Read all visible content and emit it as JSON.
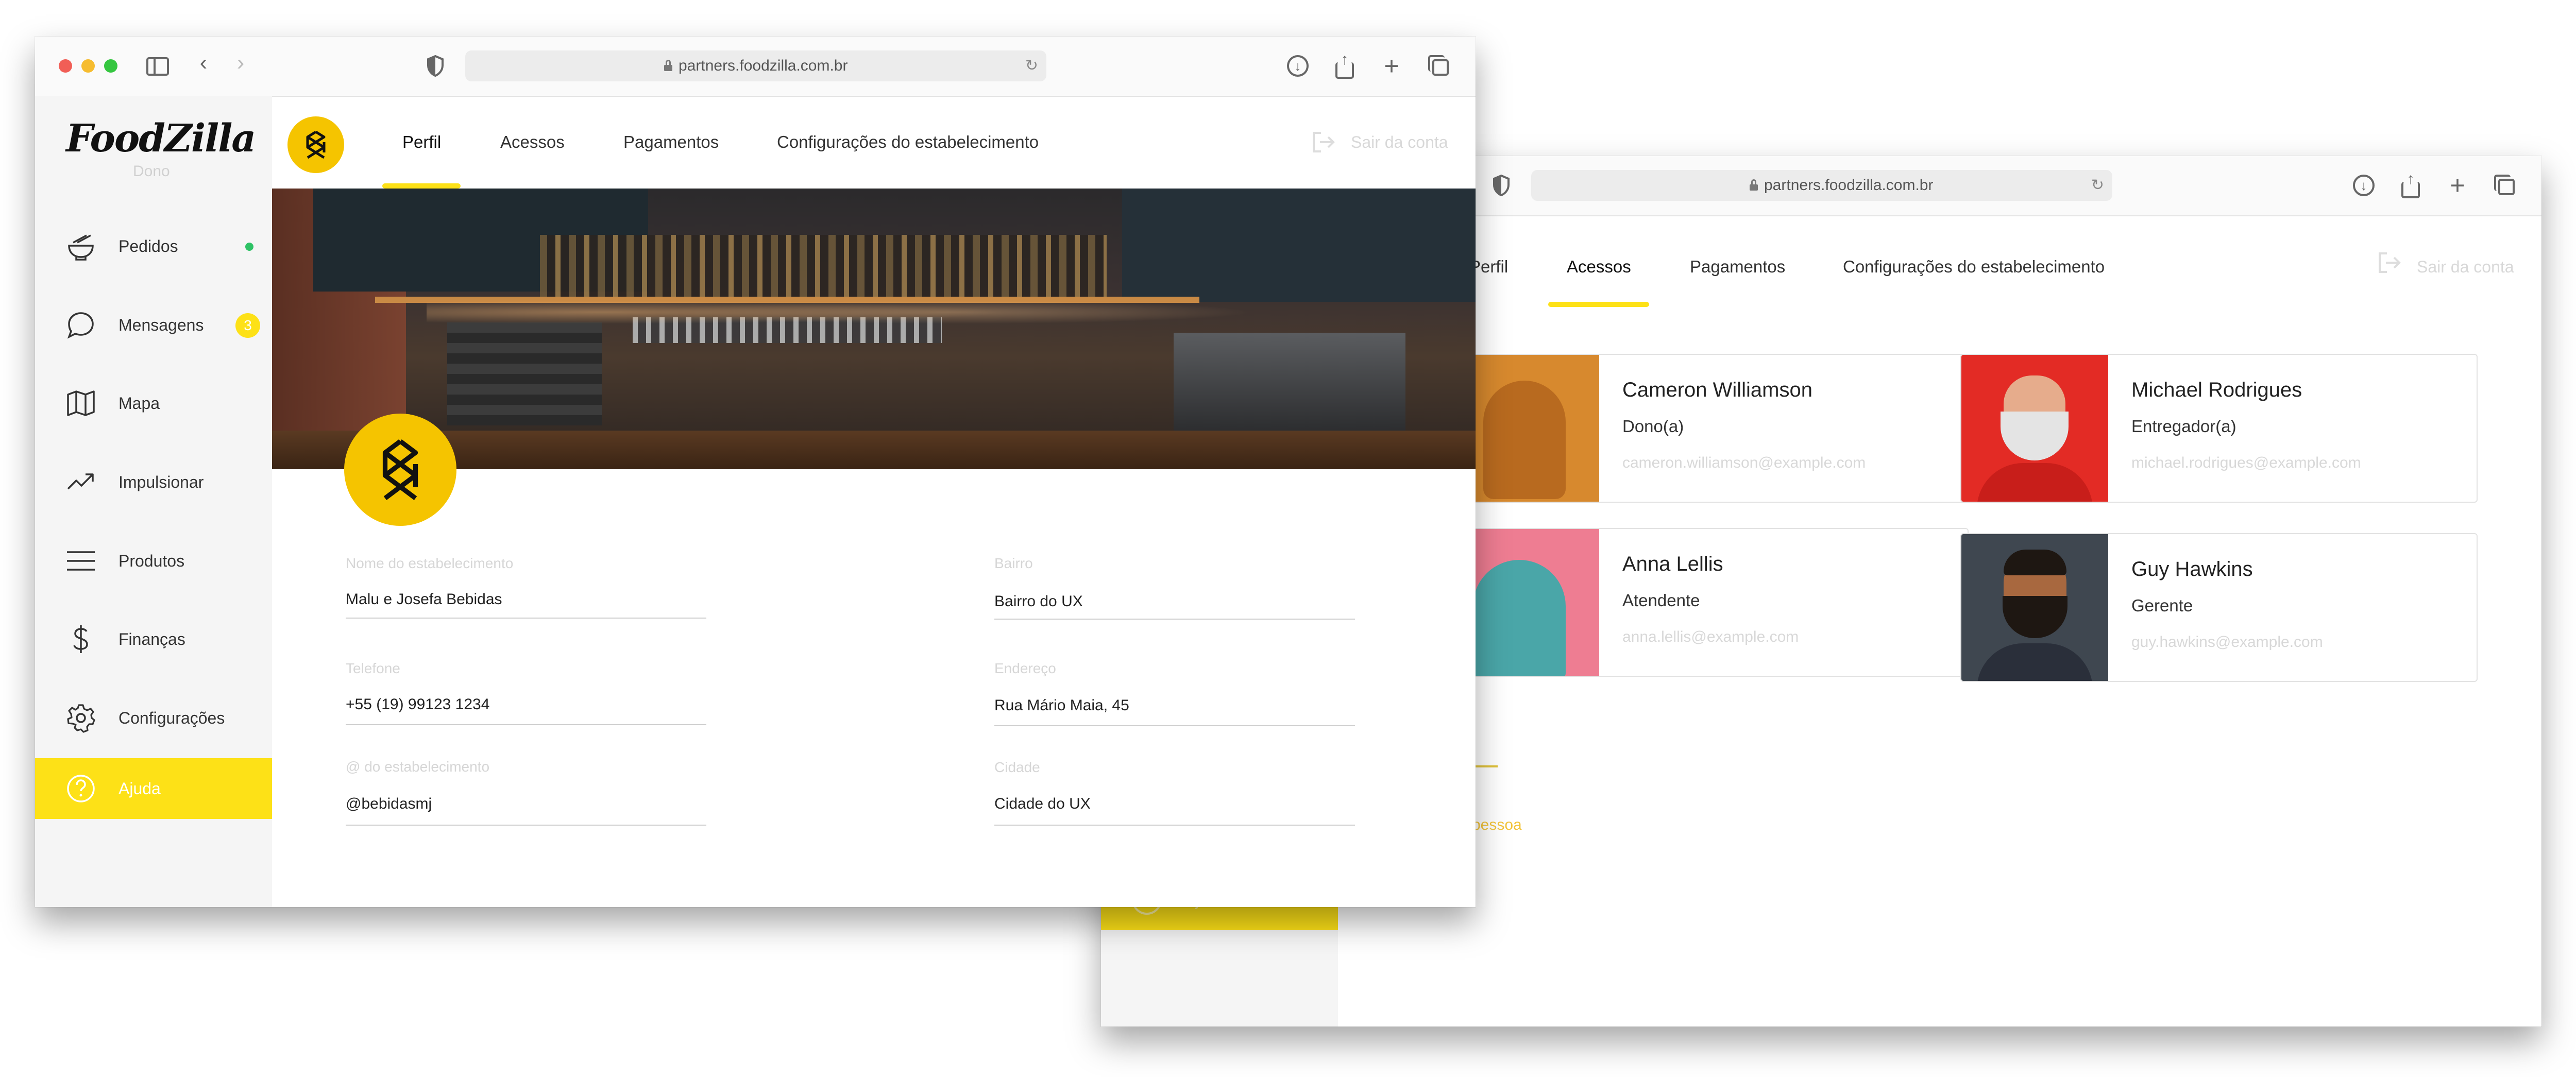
{
  "back_window": {
    "url": "partners.foodzilla.com.br",
    "tabs": [
      {
        "label": "Perfil"
      },
      {
        "label": "Acessos"
      },
      {
        "label": "Pagamentos"
      },
      {
        "label": "Configurações do estabelecimento"
      }
    ],
    "active_tab": "Acessos",
    "logout_label": "Sair da conta",
    "add_person_label": "pessoa",
    "sidebar_help_label": "Ajuda",
    "cards": [
      {
        "name": "Cameron Williamson",
        "role": "Dono(a)",
        "email": "cameron.williamson@example.com",
        "photo_color": "#d7892e"
      },
      {
        "name": "Michael Rodrigues",
        "role": "Entregador(a)",
        "email": "michael.rodrigues@example.com",
        "photo_color": "#e32b25"
      },
      {
        "name": "Anna Lellis",
        "role": "Atendente",
        "email": "anna.lellis@example.com",
        "photo_color": "#ee7d92"
      },
      {
        "name": "Guy Hawkins",
        "role": "Gerente",
        "email": "guy.hawkins@example.com",
        "photo_color": "#3f4750"
      }
    ]
  },
  "front_window": {
    "url": "partners.foodzilla.com.br",
    "logo": "FoodZilla",
    "role": "Dono",
    "sidebar": {
      "items": [
        {
          "label": "Pedidos",
          "icon": "bowl-icon"
        },
        {
          "label": "Mensagens",
          "icon": "chat-icon",
          "badge": "3"
        },
        {
          "label": "Mapa",
          "icon": "map-icon"
        },
        {
          "label": "Impulsionar",
          "icon": "trend-icon"
        },
        {
          "label": "Produtos",
          "icon": "menu-icon"
        },
        {
          "label": "Finanças",
          "icon": "dollar-icon"
        },
        {
          "label": "Configurações",
          "icon": "gear-icon"
        },
        {
          "label": "Ajuda",
          "icon": "help-icon"
        }
      ]
    },
    "tabs": [
      {
        "label": "Perfil"
      },
      {
        "label": "Acessos"
      },
      {
        "label": "Pagamentos"
      },
      {
        "label": "Configurações do estabelecimento"
      }
    ],
    "active_tab": "Perfil",
    "logout_label": "Sair da conta",
    "form": {
      "nome_label": "Nome do estabelecimento",
      "nome_value": "Malu e Josefa Bebidas",
      "telefone_label": "Telefone",
      "telefone_value": "+55 (19) 99123 1234",
      "arroba_label": "@ do estabelecimento",
      "arroba_value": "@bebidasmj",
      "bairro_label": "Bairro",
      "bairro_value": "Bairro do UX",
      "endereco_label": "Endereço",
      "endereco_value": "Rua Mário Maia, 45",
      "cidade_label": "Cidade",
      "cidade_value": "Cidade do UX"
    }
  },
  "colors": {
    "accent": "#fde117",
    "logo_yellow": "#f5c400",
    "online": "#2ec265"
  }
}
